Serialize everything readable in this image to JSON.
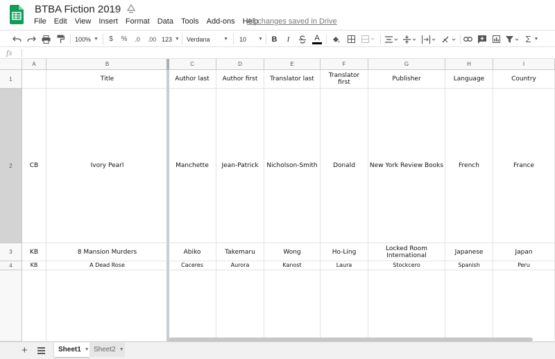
{
  "document": {
    "title": "BTBA Fiction 2019",
    "save_status": "All changes saved in Drive"
  },
  "menu": [
    "File",
    "Edit",
    "View",
    "Insert",
    "Format",
    "Data",
    "Tools",
    "Add-ons",
    "Help"
  ],
  "toolbar": {
    "zoom": "100%",
    "currency": "$",
    "percent": "%",
    "decrease_decimal": ".0",
    "increase_decimal": ".00",
    "more_formats": "123",
    "font": "Verdana",
    "font_size": "10",
    "bold": "B",
    "italic": "I",
    "text_color_letter": "A",
    "sum": "Σ"
  },
  "formula_bar": {
    "label": "fx",
    "value": ""
  },
  "columns": [
    "A",
    "B",
    "C",
    "D",
    "E",
    "F",
    "G",
    "H",
    "I"
  ],
  "rows": [
    {
      "num": "1",
      "cells": [
        "",
        "Title",
        "Author last",
        "Author first",
        "Translator last",
        "Translator first",
        "Publisher",
        "Language",
        "Country"
      ]
    },
    {
      "num": "2",
      "cells": [
        "CB",
        "Ivory Pearl",
        "Manchette",
        "Jean-Patrick",
        "Nicholson-Smith",
        "Donald",
        "New York Review Books",
        "French",
        "France"
      ]
    },
    {
      "num": "3",
      "cells": [
        "KB",
        "8 Mansion Murders",
        "Abiko",
        "Takemaru",
        "Wong",
        "Ho-Ling",
        "Locked Room International",
        "Japanese",
        "Japan"
      ]
    },
    {
      "num": "4",
      "cells": [
        "KB",
        "A Dead Rose",
        "Caceres",
        "Aurora",
        "Kanost",
        "Laura",
        "Stockcero",
        "Spanish",
        "Peru"
      ]
    }
  ],
  "sheets": [
    {
      "name": "Sheet1",
      "active": true
    },
    {
      "name": "Sheet2",
      "active": false
    }
  ],
  "colors": {
    "sheets_green": "#0f9d58",
    "freeze_bar": "#c9cdd4",
    "selected_row_header": "#d3d3d3"
  }
}
